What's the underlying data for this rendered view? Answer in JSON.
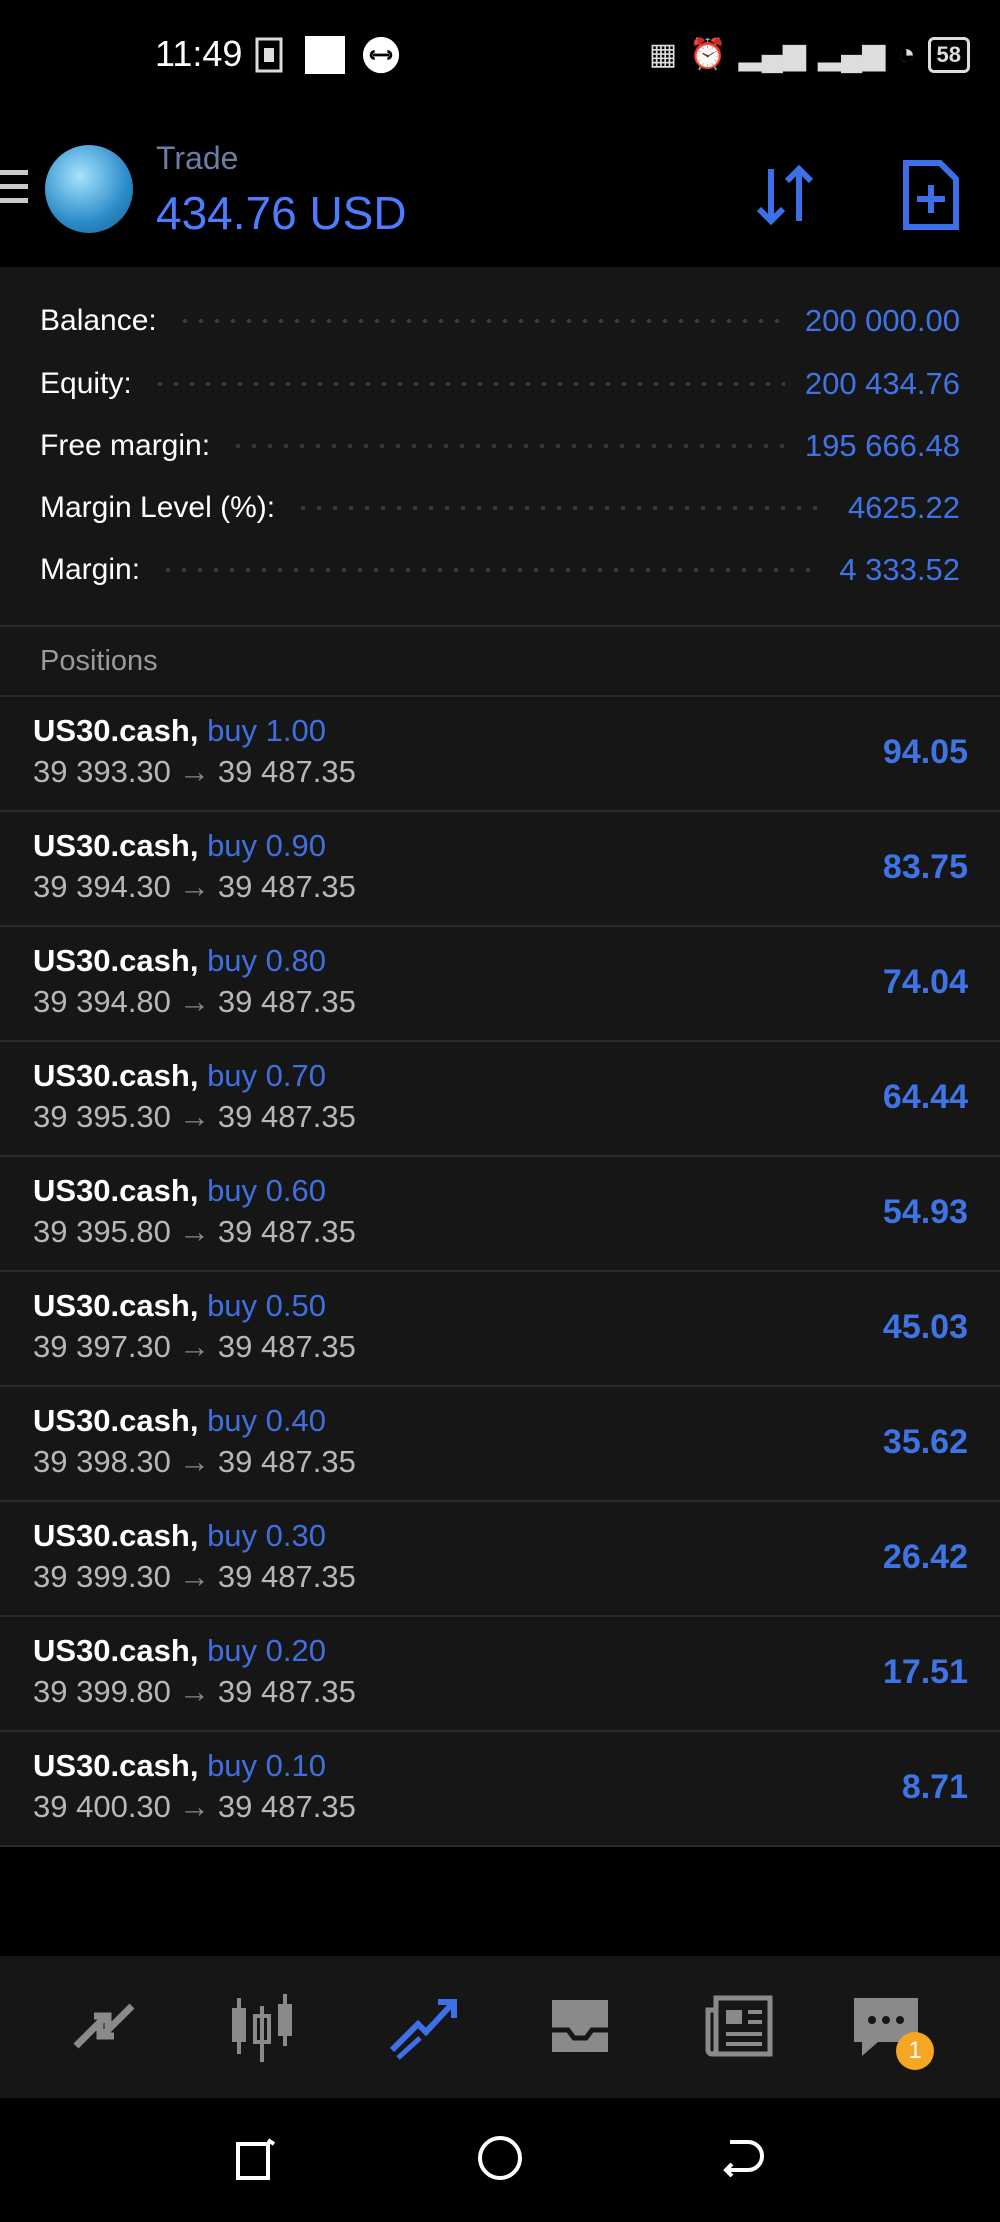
{
  "status_bar": {
    "time": "11:49",
    "battery": "58",
    "colors": {
      "icons": "#dddddd"
    }
  },
  "header": {
    "title": "Trade",
    "balance": "434.76 USD",
    "icons": [
      "menu-icon",
      "metatrader-logo",
      "sort-icon",
      "new-order-icon"
    ]
  },
  "account": {
    "rows": [
      {
        "label": "Balance:",
        "value": "200 000.00"
      },
      {
        "label": "Equity:",
        "value": "200 434.76"
      },
      {
        "label": "Free margin:",
        "value": "195 666.48"
      },
      {
        "label": "Margin Level (%):",
        "value": "4625.22"
      },
      {
        "label": "Margin:",
        "value": "4 333.52"
      }
    ]
  },
  "positions": {
    "title": "Positions",
    "items": [
      {
        "symbol": "US30.cash,",
        "type": "buy 1.00",
        "open": "39 393.30",
        "current": "39 487.35",
        "profit": "94.05"
      },
      {
        "symbol": "US30.cash,",
        "type": "buy 0.90",
        "open": "39 394.30",
        "current": "39 487.35",
        "profit": "83.75"
      },
      {
        "symbol": "US30.cash,",
        "type": "buy 0.80",
        "open": "39 394.80",
        "current": "39 487.35",
        "profit": "74.04"
      },
      {
        "symbol": "US30.cash,",
        "type": "buy 0.70",
        "open": "39 395.30",
        "current": "39 487.35",
        "profit": "64.44"
      },
      {
        "symbol": "US30.cash,",
        "type": "buy 0.60",
        "open": "39 395.80",
        "current": "39 487.35",
        "profit": "54.93"
      },
      {
        "symbol": "US30.cash,",
        "type": "buy 0.50",
        "open": "39 397.30",
        "current": "39 487.35",
        "profit": "45.03"
      },
      {
        "symbol": "US30.cash,",
        "type": "buy 0.40",
        "open": "39 398.30",
        "current": "39 487.35",
        "profit": "35.62"
      },
      {
        "symbol": "US30.cash,",
        "type": "buy 0.30",
        "open": "39 399.30",
        "current": "39 487.35",
        "profit": "26.42"
      },
      {
        "symbol": "US30.cash,",
        "type": "buy 0.20",
        "open": "39 399.80",
        "current": "39 487.35",
        "profit": "17.51"
      },
      {
        "symbol": "US30.cash,",
        "type": "buy 0.10",
        "open": "39 400.30",
        "current": "39 487.35",
        "profit": "8.71"
      }
    ],
    "arrow": "→"
  },
  "bottom_nav": {
    "items": [
      "quotes-icon",
      "chart-icon",
      "trade-icon",
      "history-icon",
      "news-icon",
      "messages-icon"
    ],
    "active": "trade-icon",
    "messages_badge": "1"
  },
  "colors": {
    "accent": "#3f74e6",
    "background": "#000000",
    "panel": "#161616",
    "badge": "#f5a623"
  }
}
